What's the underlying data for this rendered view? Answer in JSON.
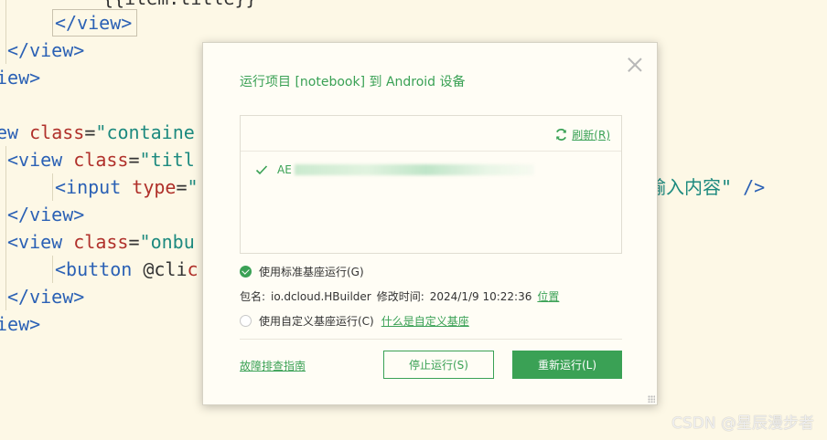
{
  "editor": {
    "lines": [
      {
        "t1": "{{item.title}}"
      },
      {
        "tag": "</view>"
      },
      {
        "tag": "</view>"
      },
      {
        "tag": "iew>"
      },
      {
        "tag": "ew",
        "attr": "class",
        "eq": "=",
        "str": "\"containe"
      },
      {
        "tag": "<view",
        "attr": "class",
        "eq": "=",
        "str": "\"titl"
      },
      {
        "tag": "<input",
        "attr": "type",
        "eq": "=",
        "str": "\""
      },
      {
        "tag": "</view>"
      },
      {
        "tag": "<view",
        "attr": "class",
        "eq": "=",
        "str": "\"onbu"
      },
      {
        "tag": "<button",
        "plain": " @cli",
        "attr": "c"
      },
      {
        "tag": "</view>"
      },
      {
        "tag": "iew>"
      }
    ],
    "right_fragment_str": "输入内容\"",
    "right_fragment_tag": " />"
  },
  "dialog": {
    "title": "运行项目 [notebook] 到 Android 设备",
    "refresh_label": "刷新(R)",
    "device_prefix": "AE",
    "option_standard": "使用标准基座运行(G)",
    "package_label": "包名:",
    "package_value": "io.dcloud.HBuilder",
    "modified_label": "修改时间:",
    "modified_value": "2024/1/9 10:22:36",
    "location_link": "位置",
    "option_custom": "使用自定义基座运行(C)",
    "what_is_custom_link": "什么是自定义基座",
    "guide_link": "故障排查指南",
    "stop_button": "停止运行(S)",
    "rerun_button": "重新运行(L)",
    "accent_color": "#3aa155"
  },
  "watermark": "CSDN @星辰漫步者"
}
